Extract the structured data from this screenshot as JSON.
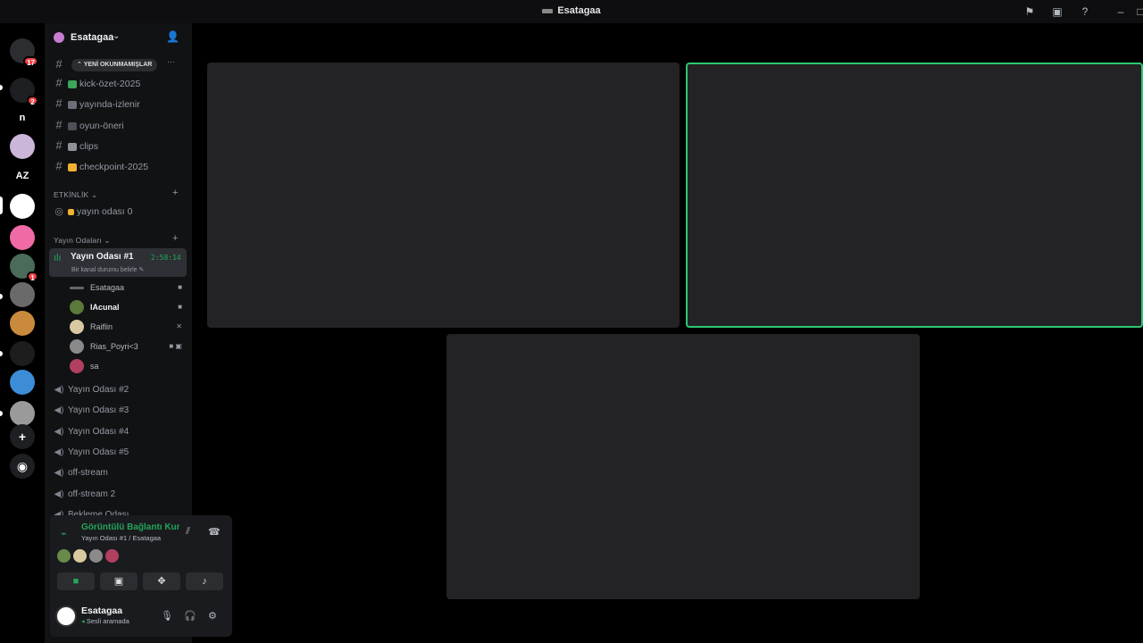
{
  "window": {
    "title": "Esatagaa"
  },
  "titlebar_icons": [
    "flag-icon",
    "inbox-icon",
    "help-icon",
    "minimize-icon",
    "maximize-icon"
  ],
  "rail": {
    "servers": [
      {
        "name": "discord-home",
        "label": "",
        "badge": "17",
        "color": "#2b2d31"
      },
      {
        "name": "server-group",
        "label": "",
        "badge": "2",
        "color": "#1e1f22"
      },
      {
        "name": "server-n",
        "label": "n",
        "badge": "",
        "color": "#000000"
      },
      {
        "name": "server-anime-1",
        "label": "",
        "badge": "",
        "color": "#c9b6d8"
      },
      {
        "name": "server-az",
        "label": "AZ",
        "badge": "",
        "color": "#000000"
      },
      {
        "name": "server-esatagaa",
        "label": "",
        "badge": "",
        "color": "#ffffff"
      },
      {
        "name": "server-anime-2",
        "label": "",
        "badge": "",
        "color": "#f06aa5"
      },
      {
        "name": "server-game",
        "label": "",
        "badge": "1",
        "color": "#4a6a5a"
      },
      {
        "name": "server-stripes",
        "label": "",
        "badge": "",
        "color": "#6a6a6a"
      },
      {
        "name": "server-tiger",
        "label": "",
        "badge": "",
        "color": "#c98a3b"
      },
      {
        "name": "server-dark",
        "label": "",
        "badge": "",
        "color": "#1d1d1d"
      },
      {
        "name": "server-blue",
        "label": "",
        "badge": "",
        "color": "#3c8dd6"
      },
      {
        "name": "server-group-2",
        "label": "",
        "badge": "",
        "color": "#9a9a9a"
      }
    ]
  },
  "sidebar": {
    "server_name": "Esatagaa",
    "unread_pill": "YENİ OKUNMAMIŞLAR",
    "text_channels": [
      {
        "name": "kick-özet-2025",
        "emoji_color": "#3ba55c"
      },
      {
        "name": "yayında-izlenir",
        "emoji_color": "#6d6f78"
      },
      {
        "name": "oyun-öneri",
        "emoji_color": "#4e5058"
      },
      {
        "name": "clips",
        "emoji_color": "#8e9297"
      },
      {
        "name": "checkpoint-2025",
        "emoji_color": "#f0b232"
      }
    ],
    "category_events": "ETKİNLİK",
    "event_channel": "yayın odası 0",
    "category_streams": "Yayın Odaları",
    "active_channel": {
      "name": "Yayın Odası #1",
      "timer": "2:58:14",
      "status": "Bir kanal durumu belirle"
    },
    "members": [
      {
        "name": "Esatagaa",
        "bold": false,
        "avatar": "#666666",
        "right": "■"
      },
      {
        "name": "lAcunal",
        "bold": true,
        "avatar": "#5a7a3a",
        "right": "■"
      },
      {
        "name": "Raiflin",
        "bold": false,
        "avatar": "#d9c9a0",
        "right": "✕"
      },
      {
        "name": "Rias_Poyri<3",
        "bold": false,
        "avatar": "#8a8a8a",
        "right": "■ ▣"
      },
      {
        "name": "sa",
        "bold": false,
        "avatar": "#b04060",
        "right": ""
      }
    ],
    "voice_channels": [
      "Yayın Odası #2",
      "Yayın Odası #3",
      "Yayın Odası #4",
      "Yayın Odası #5",
      "off-stream",
      "off-stream 2",
      "Bekleme Odası"
    ]
  },
  "voice_panel": {
    "title": "Görüntülü Bağlantı Kuruldu",
    "subtitle": "Yayın Odası #1 / Esatagaa",
    "avatars": [
      "#6a8a4a",
      "#d9c9a0",
      "#8a8a8a",
      "#b04060"
    ],
    "buttons": [
      "camera-icon",
      "screen-share-icon",
      "activities-icon",
      "soundboard-icon"
    ]
  },
  "user_panel": {
    "name": "Esatagaa",
    "status": "Sesli aramada"
  },
  "stage": {
    "tiles": [
      {
        "name": "video-tile-1",
        "speaking": false
      },
      {
        "name": "video-tile-2",
        "speaking": true
      },
      {
        "name": "video-tile-3",
        "speaking": false
      }
    ]
  }
}
